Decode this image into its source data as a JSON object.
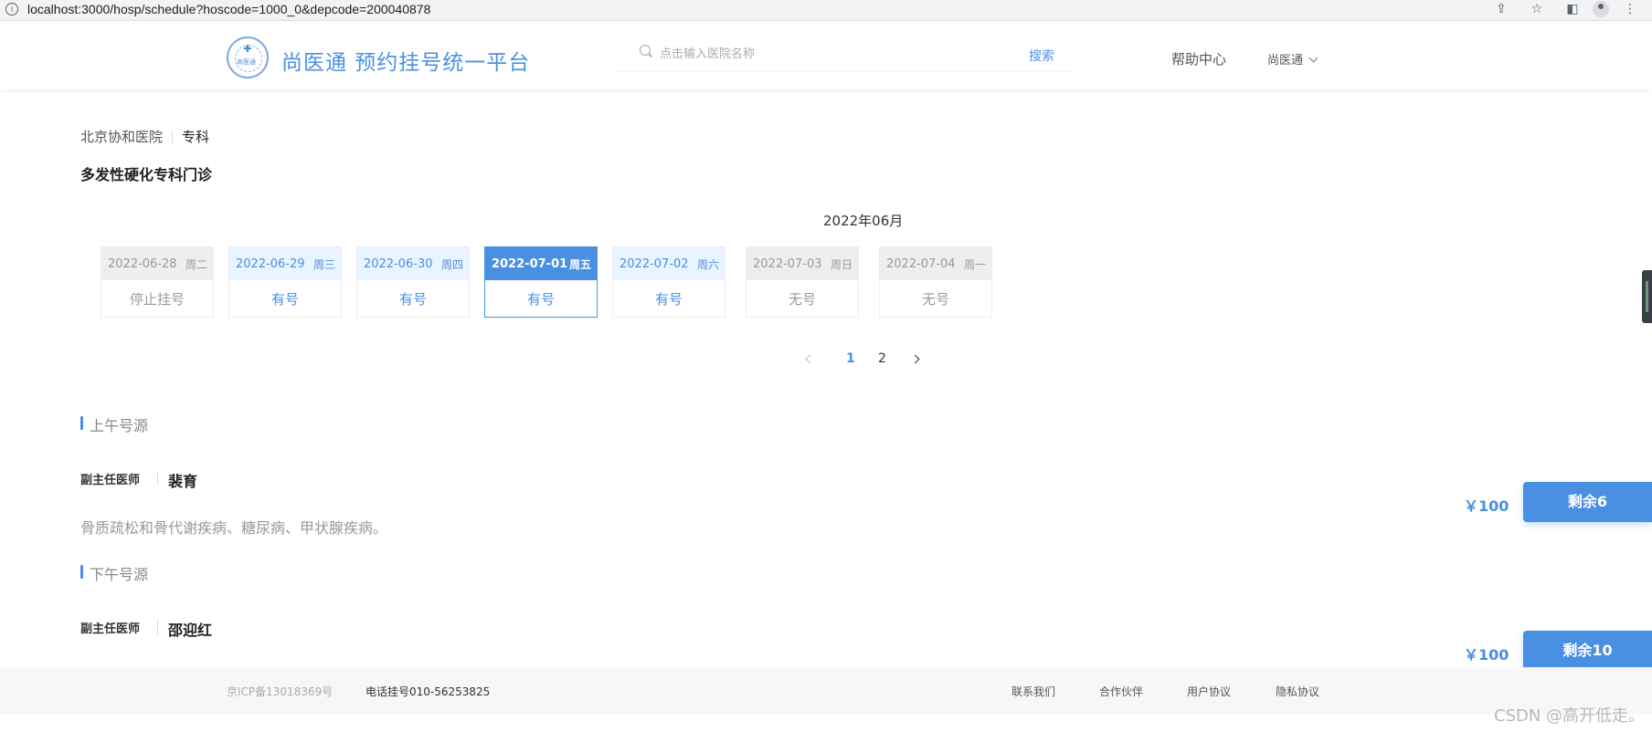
{
  "browser": {
    "url": "localhost:3000/hosp/schedule?hoscode=1000_0&depcode=200040878",
    "info_icon": "i"
  },
  "header": {
    "logo_text": "尚医通",
    "title": "尚医通 预约挂号统一平台",
    "search_placeholder": "点击输入医院名称",
    "search_button": "搜索",
    "help": "帮助中心",
    "user": "尚医通"
  },
  "breadcrumb": {
    "hospital": "北京协和医院",
    "category": "专科"
  },
  "department": "多发性硬化专科门诊",
  "calendar": {
    "month": "2022年06月",
    "days": [
      {
        "date": "2022-06-28",
        "weekday": "周二",
        "status": "停止挂号",
        "style": "gray"
      },
      {
        "date": "2022-06-29",
        "weekday": "周三",
        "status": "有号",
        "style": "blue"
      },
      {
        "date": "2022-06-30",
        "weekday": "周四",
        "status": "有号",
        "style": "blue"
      },
      {
        "date": "2022-07-01",
        "weekday": "周五",
        "status": "有号",
        "style": "active"
      },
      {
        "date": "2022-07-02",
        "weekday": "周六",
        "status": "有号",
        "style": "blue"
      },
      {
        "date": "2022-07-03",
        "weekday": "周日",
        "status": "无号",
        "style": "gray"
      },
      {
        "date": "2022-07-04",
        "weekday": "周一",
        "status": "无号",
        "style": "gray"
      }
    ],
    "pages": [
      "1",
      "2"
    ],
    "current_page": "1"
  },
  "morning": {
    "title": "上午号源",
    "doctor": {
      "level": "副主任医师",
      "name": "裴育",
      "skill": "骨质疏松和骨代谢疾病、糖尿病、甲状腺疾病。",
      "price": "￥100",
      "remain": "剩余6"
    }
  },
  "afternoon": {
    "title": "下午号源",
    "doctor": {
      "level": "副主任医师",
      "name": "邵迎红",
      "price": "￥100",
      "remain": "剩余10"
    }
  },
  "footer": {
    "icp": "京ICP备13018369号",
    "phone": "电话挂号010-56253825",
    "links": [
      "联系我们",
      "合作伙伴",
      "用户协议",
      "隐私协议"
    ]
  },
  "watermark": "CSDN @高开低走。",
  "colors": {
    "accent": "#4a90e2",
    "gray_bg": "#eeeeee",
    "light_blue_bg": "#e8f4ff"
  }
}
